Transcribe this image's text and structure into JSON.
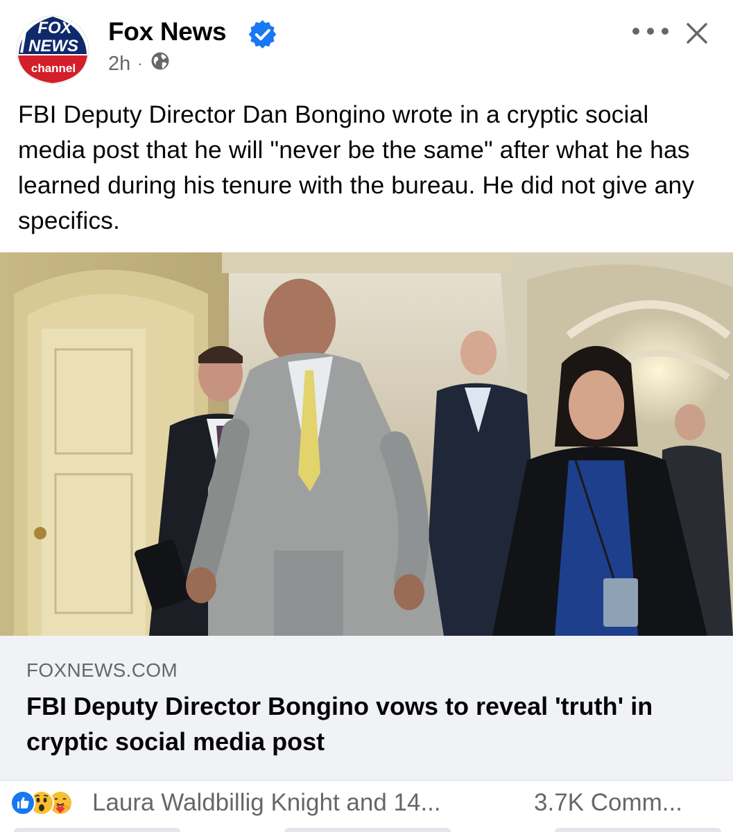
{
  "post": {
    "page_name": "Fox News",
    "avatar_text": {
      "line1": "FOX",
      "line2": "NEWS",
      "line3": "channel"
    },
    "time": "2h",
    "separator": "·",
    "audience_icon": "globe-icon",
    "verified_icon": "verified-badge-icon",
    "caption": "FBI Deputy Director Dan Bongino wrote in a cryptic social media post that he will \"never be the same\" after what he has learned during his tenure with the bureau. He did not give any specifics."
  },
  "link_preview": {
    "domain": "FOXNEWS.COM",
    "title": "FBI Deputy Director Bongino vows to reveal 'truth' in cryptic social media post"
  },
  "reactions": {
    "icons": [
      "like-icon",
      "wow-icon",
      "care-icon"
    ],
    "reactors_text": "Laura Waldbillig Knight and 14...",
    "comments_text": "3.7K Comm..."
  },
  "colors": {
    "brand_blue": "#1877f2",
    "secondary_text": "#65676b",
    "link_bg": "#f0f2f5",
    "fox_red": "#d31f29",
    "fox_navy": "#0f2a6b"
  }
}
